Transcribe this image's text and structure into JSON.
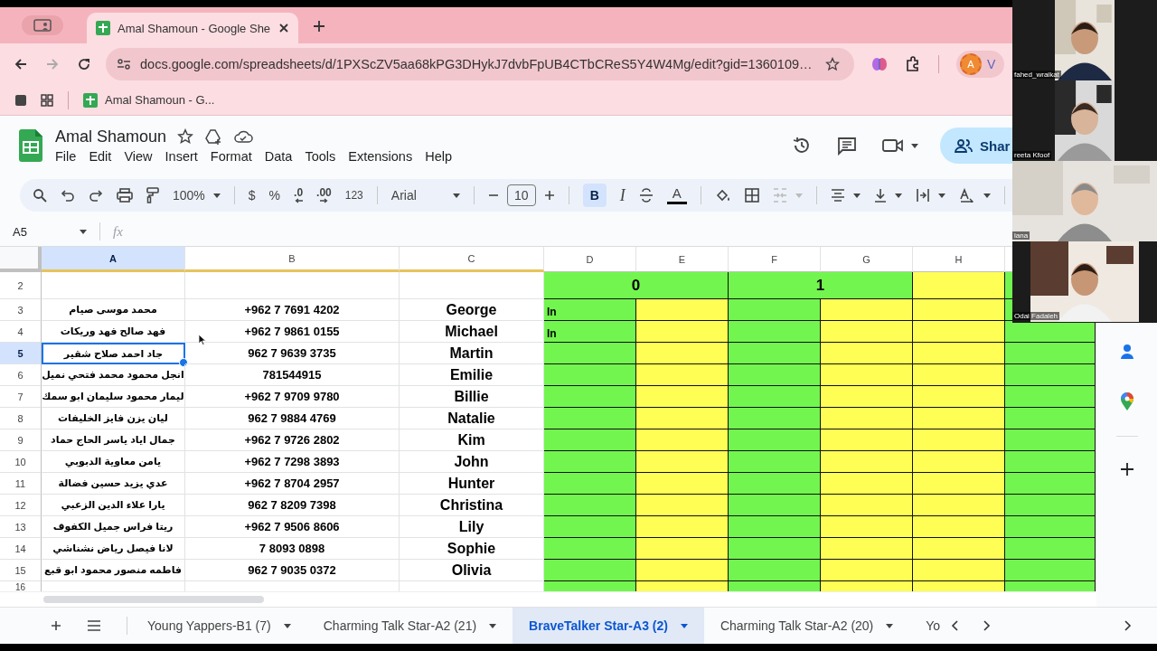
{
  "browser": {
    "tab_title": "Amal Shamoun - Google She",
    "url": "docs.google.com/spreadsheets/d/1PXScZV5aa68kPG3DHykJ7dvbFpUB4CTbCReS5Y4W4Mg/edit?gid=1360109…",
    "bookmark": "Amal Shamoun - G...",
    "profile_initial": "A",
    "profile_label": "V"
  },
  "doc": {
    "title": "Amal Shamoun",
    "menu": [
      "File",
      "Edit",
      "View",
      "Insert",
      "Format",
      "Data",
      "Tools",
      "Extensions",
      "Help"
    ],
    "share": "Shar"
  },
  "toolbar": {
    "zoom": "100%",
    "currency": "$",
    "percent": "%",
    "decrease_decimals": ".0",
    "increase_decimals": ".00",
    "number_format": "123",
    "font": "Arial",
    "font_size": "10",
    "bold_label": "B",
    "bold_selected": true,
    "italic_label": "I",
    "text_color_label": "A"
  },
  "formula_bar": {
    "cell_ref": "A5",
    "fx": "fx"
  },
  "columns": [
    {
      "label": "A",
      "selected": true
    },
    {
      "label": "B",
      "selected": false
    },
    {
      "label": "C",
      "selected": false
    },
    {
      "label": "D",
      "selected": false,
      "color": "#72f64f"
    },
    {
      "label": "E",
      "selected": false,
      "color": "#fefe55"
    },
    {
      "label": "F",
      "selected": false,
      "color": "#72f64f"
    },
    {
      "label": "G",
      "selected": false,
      "color": "#fefe55"
    },
    {
      "label": "H",
      "selected": false,
      "color": "#fefe55"
    },
    {
      "color": "#72f64f"
    }
  ],
  "header_row": {
    "number": "2",
    "groups": [
      "0",
      "1"
    ]
  },
  "rows": [
    {
      "number": "3",
      "name": "محمد موسى صيام",
      "phone": "+962 7 7691 4202",
      "english": "George",
      "d": "In",
      "selected": false
    },
    {
      "number": "4",
      "name": "فهد صالح فهد وريكات",
      "phone": "+962 7 9861 0155",
      "english": "Michael",
      "d": "In",
      "selected": false
    },
    {
      "number": "5",
      "name": "جاد احمد صلاح شقير",
      "phone": "962 7 9639 3735",
      "english": "Martin",
      "selected": true
    },
    {
      "number": "6",
      "name": "انجل محمود محمد فتحي نميل",
      "phone": "781544915",
      "english": "Emilie",
      "selected": false
    },
    {
      "number": "7",
      "name": "ليمار محمود سليمان ابو سمك",
      "phone": "+962 7 9709 9780",
      "english": "Billie",
      "selected": false
    },
    {
      "number": "8",
      "name": "ليان يزن فايز الخليفات",
      "phone": "962 7 9884 4769",
      "english": "Natalie",
      "selected": false
    },
    {
      "number": "9",
      "name": "جمال اياد ياسر الحاج حماد",
      "phone": "+962 7 9726 2802",
      "english": "Kim",
      "selected": false
    },
    {
      "number": "10",
      "name": "يامن معاوية الدبوبي",
      "phone": "+962 7 7298 3893",
      "english": "John",
      "selected": false
    },
    {
      "number": "11",
      "name": "عدي يزيد حسين فضالة",
      "phone": "+962 7 8704 2957",
      "english": "Hunter",
      "selected": false
    },
    {
      "number": "12",
      "name": "يارا علاء الدين الزعبي",
      "phone": "962 7 8209 7398",
      "english": "Christina",
      "selected": false
    },
    {
      "number": "13",
      "name": "ريتا فراس جميل الكفوف",
      "phone": "+962 7 9506 8606",
      "english": "Lily",
      "selected": false
    },
    {
      "number": "14",
      "name": "لانا فيصل رياض نشناشي",
      "phone": "7 8093 0898",
      "english": "Sophie",
      "selected": false
    },
    {
      "number": "15",
      "name": "فاطمه منصور محمود ابو قبع",
      "phone": "962 7 9035 0372",
      "english": "Olivia",
      "selected": false
    }
  ],
  "partial_row": "16",
  "sheet_tabs": [
    {
      "label": "Young Yappers-B1 (7)",
      "selected": false
    },
    {
      "label": "Charming Talk Star-A2 (21)",
      "selected": false
    },
    {
      "label": "BraveTalker Star-A3 (2)",
      "selected": true
    },
    {
      "label": "Charming Talk Star-A2 (20)",
      "selected": false
    },
    {
      "label": "Yo",
      "selected": false
    }
  ],
  "participants": [
    {
      "name": "fahed_wraikat"
    },
    {
      "name": "reeta Kfoof"
    },
    {
      "name": "lana"
    },
    {
      "name": "Odai Fadaleh"
    }
  ]
}
